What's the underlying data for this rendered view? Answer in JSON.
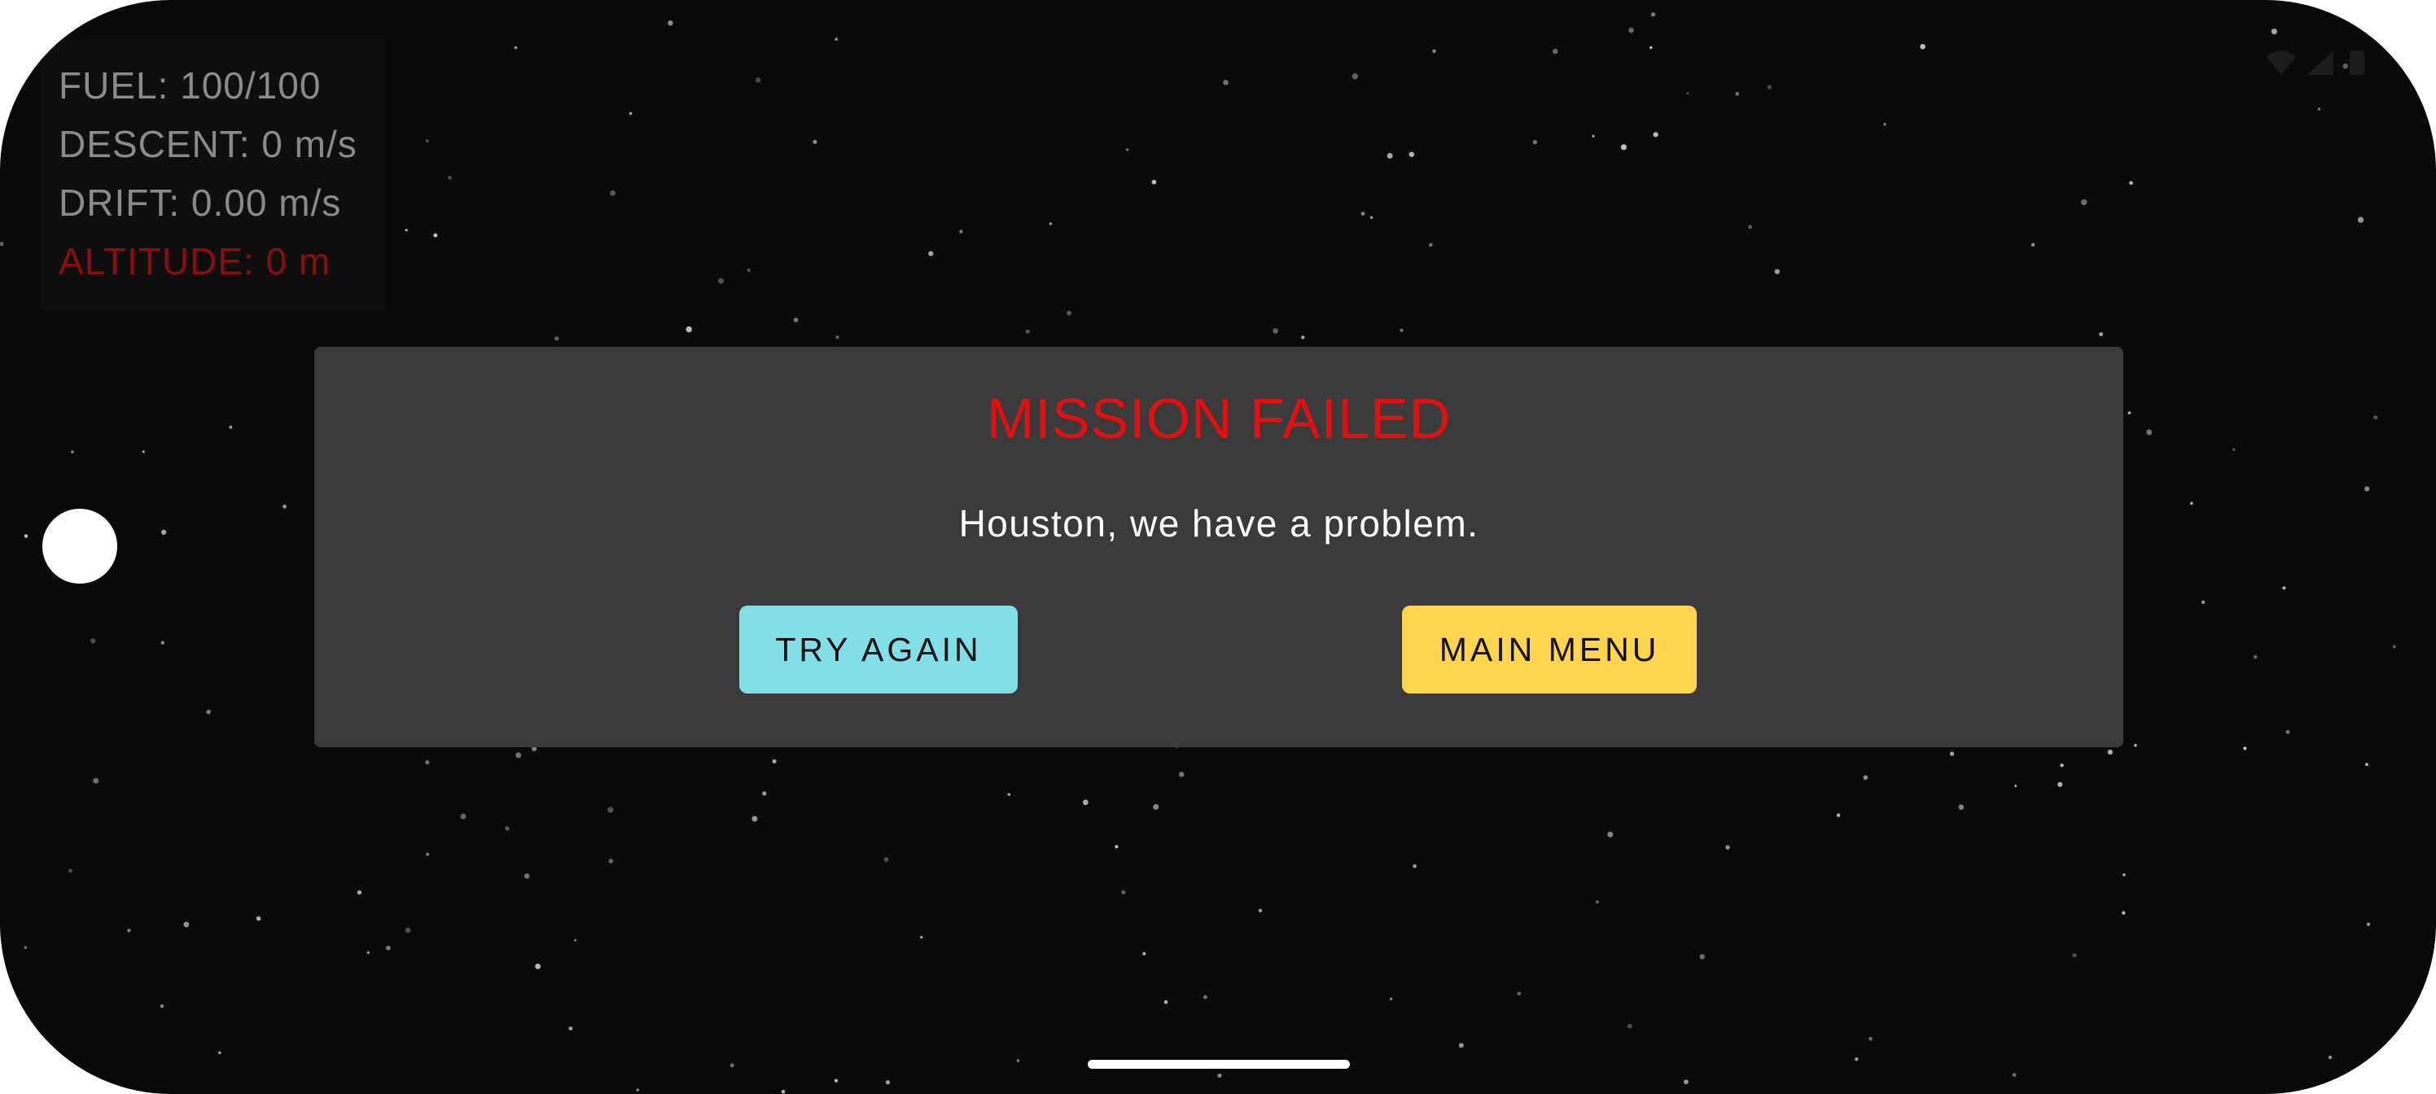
{
  "hud": {
    "fuel": "FUEL: 100/100",
    "descent": "DESCENT: 0 m/s",
    "drift": "DRIFT: 0.00 m/s",
    "altitude": "ALTITUDE: 0 m",
    "text_color": "#8a8a8a",
    "alert_color": "#8b0e0e"
  },
  "status_bar": {
    "icons": [
      "wifi-icon",
      "signal-icon",
      "battery-icon"
    ]
  },
  "dialog": {
    "title": "MISSION FAILED",
    "title_color": "#e01010",
    "message": "Houston, we have a problem.",
    "buttons": {
      "try_again": {
        "label": "TRY AGAIN",
        "color": "#82dfe8"
      },
      "main_menu": {
        "label": "MAIN MENU",
        "color": "#ffd54f"
      }
    }
  },
  "colors": {
    "background": "#0a0a0a",
    "dialog_bg": "#3a3a3a"
  }
}
